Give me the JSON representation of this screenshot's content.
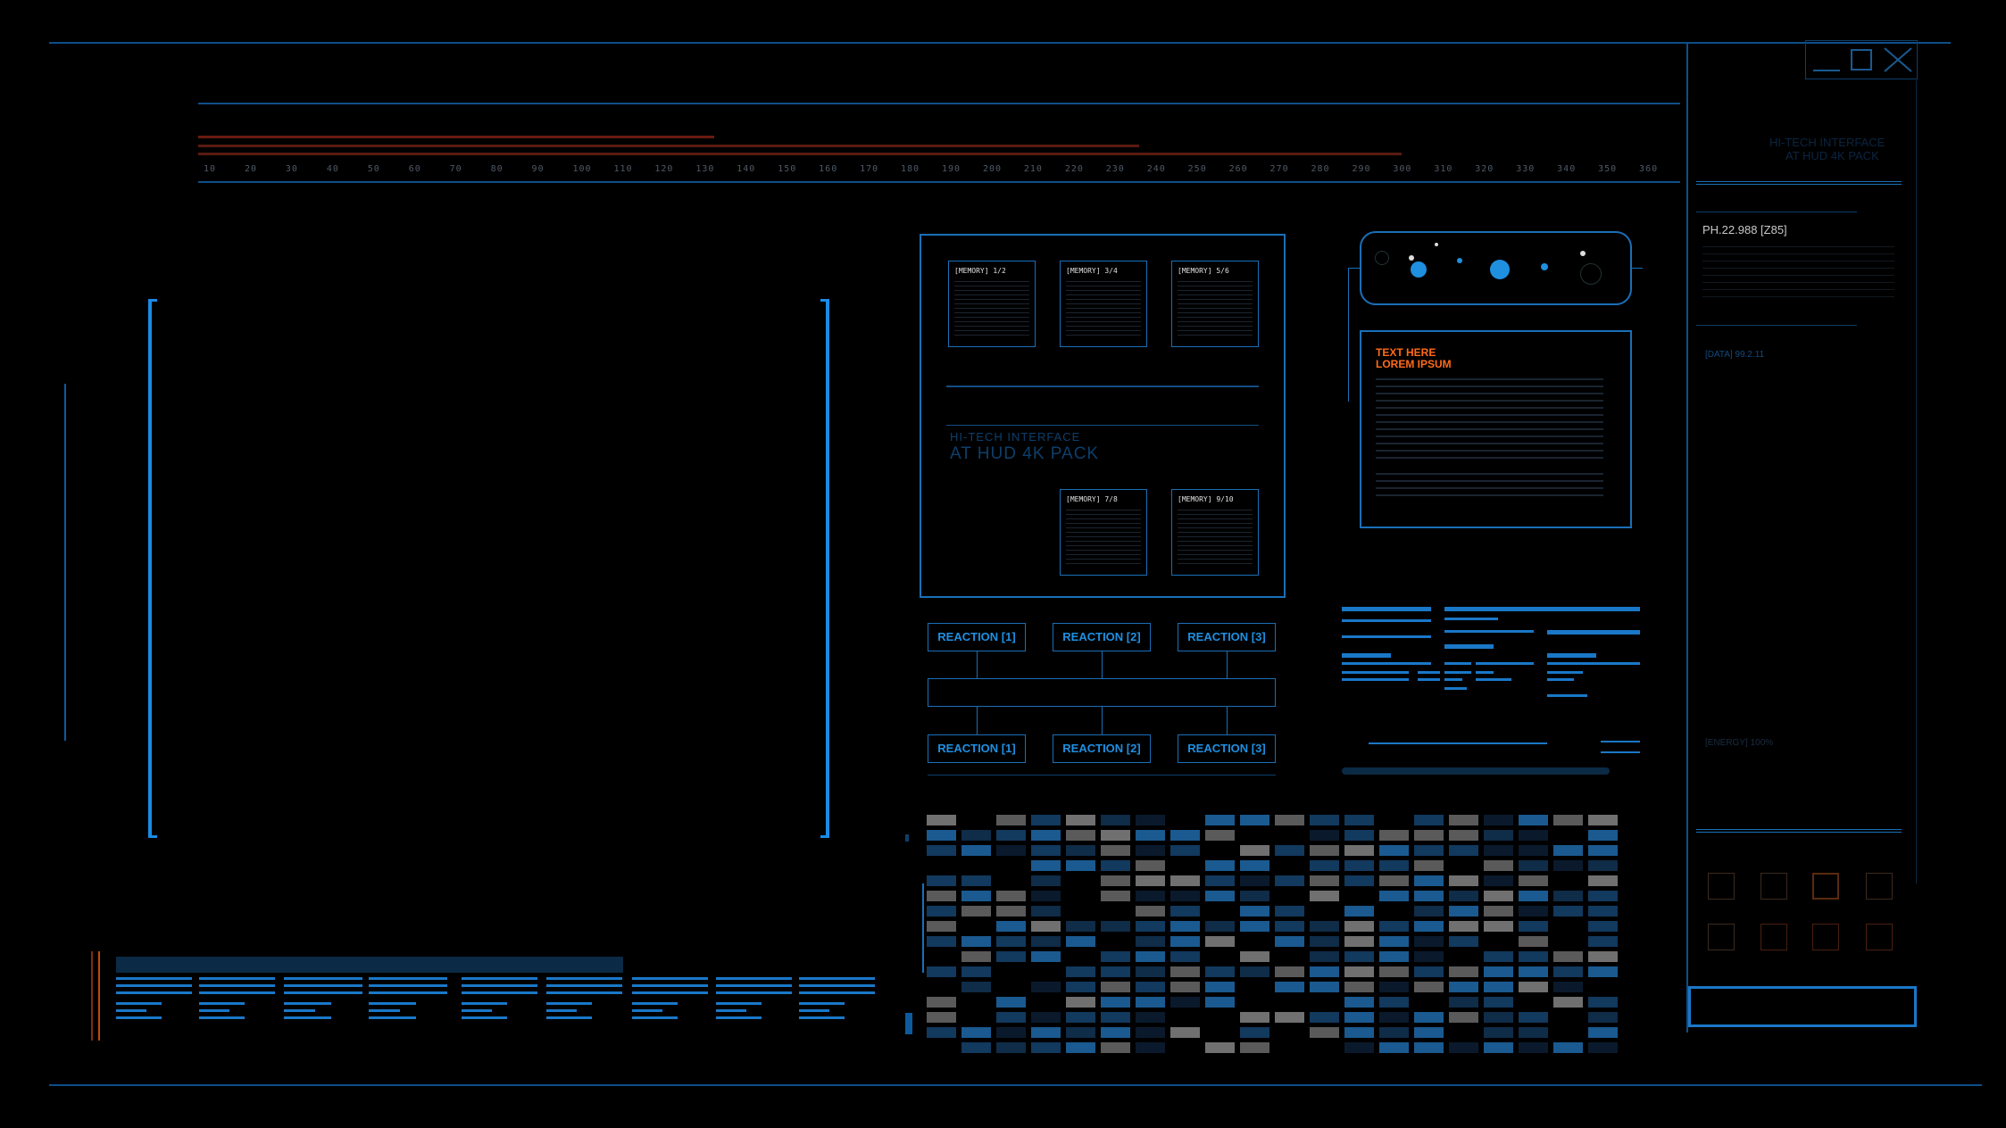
{
  "top_left_caption": "",
  "ruler": {
    "ticks": [
      "10",
      "20",
      "30",
      "40",
      "50",
      "60",
      "70",
      "80",
      "90",
      "100",
      "110",
      "120",
      "130",
      "140",
      "150",
      "160",
      "170",
      "180",
      "190",
      "200",
      "210",
      "220",
      "230",
      "240",
      "250",
      "260",
      "270",
      "280",
      "290",
      "300",
      "310",
      "320",
      "330",
      "340",
      "350",
      "360"
    ]
  },
  "memory_panel": {
    "cards_top": [
      "[MEMORY] 1/2",
      "[MEMORY] 3/4",
      "[MEMORY] 5/6"
    ],
    "cards_bottom": [
      "[MEMORY] 7/8",
      "[MEMORY] 9/10"
    ],
    "subtitle": "HI-TECH INTERFACE",
    "title": "AT HUD 4K PACK"
  },
  "reactions_top": [
    "REACTION [1]",
    "REACTION [2]",
    "REACTION [3]"
  ],
  "reactions_bottom": [
    "REACTION [1]",
    "REACTION [2]",
    "REACTION [3]"
  ],
  "text_box": {
    "line1": "TEXT HERE",
    "line2": "LOREM IPSUM"
  },
  "right_panel": {
    "header_line1": "HI-TECH INTERFACE",
    "header_line2": "AT HUD 4K PACK",
    "code": "PH.22.988 [Z85]",
    "data_label": "[DATA] 99.2.11",
    "energy_label": "[ENERGY] 100%"
  },
  "window_controls": {
    "minimize": "minimize-icon",
    "maximize": "maximize-icon",
    "close": "close-icon"
  },
  "colors": {
    "accent": "#1f8fe0",
    "dim": "#0d4f8a",
    "orange": "#ff6a1a",
    "red": "#6b1a10"
  }
}
